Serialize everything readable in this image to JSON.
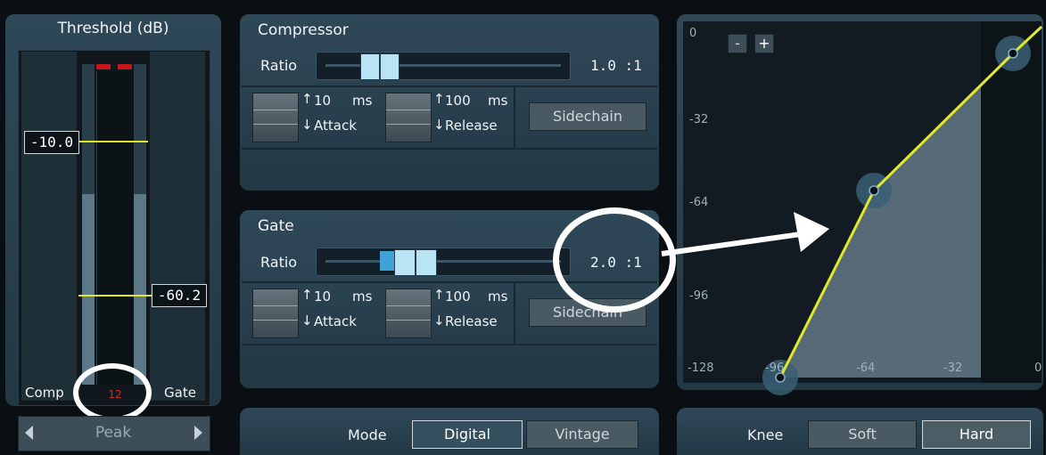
{
  "threshold": {
    "title": "Threshold (dB)",
    "comp_value": "-10.0",
    "gate_value": "-60.2",
    "comp_label": "Comp",
    "gate_label": "Gate",
    "peak_number": "12",
    "meter_mode": "Peak"
  },
  "compressor": {
    "title": "Compressor",
    "ratio_label": "Ratio",
    "ratio_value": "1.0 :1",
    "attack_value": "10",
    "attack_unit": "ms",
    "attack_label": "Attack",
    "release_value": "100",
    "release_unit": "ms",
    "release_label": "Release",
    "sidechain_label": "Sidechain"
  },
  "gate": {
    "title": "Gate",
    "ratio_label": "Ratio",
    "ratio_value": "2.0 :1",
    "attack_value": "10",
    "attack_unit": "ms",
    "attack_label": "Attack",
    "release_value": "100",
    "release_unit": "ms",
    "release_label": "Release",
    "sidechain_label": "Sidechain"
  },
  "mode": {
    "label": "Mode",
    "options": [
      "Digital",
      "Vintage"
    ],
    "selected": "Digital"
  },
  "knee": {
    "label": "Knee",
    "options": [
      "Soft",
      "Hard"
    ],
    "selected": "Hard"
  },
  "graph": {
    "zoom_out": "-",
    "zoom_in": "+",
    "y_ticks": [
      "0",
      "-32",
      "-64",
      "-96",
      "-128"
    ],
    "x_ticks": [
      "-96",
      "-64",
      "-32",
      "0"
    ]
  },
  "colors": {
    "curve": "#e4e82a",
    "highlight": "#ffffff",
    "meter_peak": "#c01818"
  }
}
